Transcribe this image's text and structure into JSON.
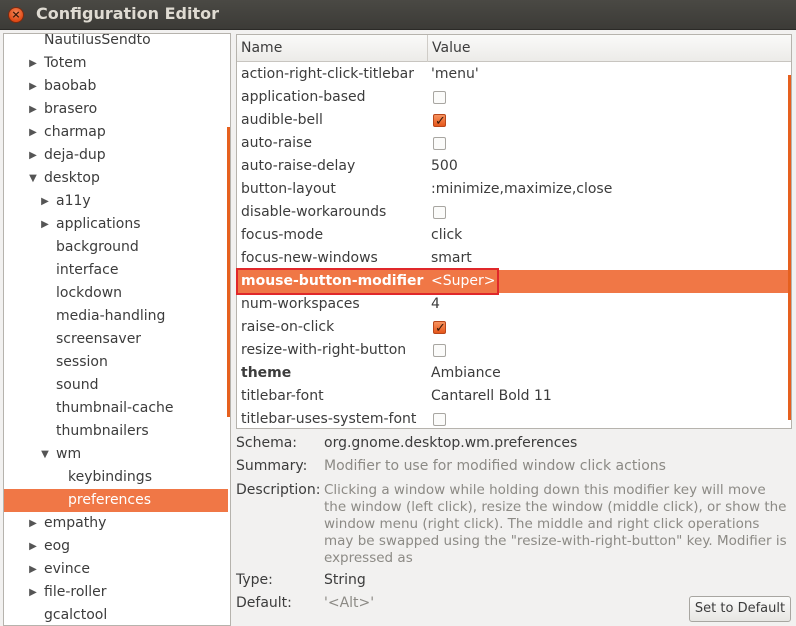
{
  "window": {
    "title": "Configuration Editor"
  },
  "tree": [
    {
      "label": "NautilusSendto",
      "depth": 0,
      "expander": "none",
      "selected": false
    },
    {
      "label": "Totem",
      "depth": 0,
      "expander": "collapsed",
      "selected": false
    },
    {
      "label": "baobab",
      "depth": 0,
      "expander": "collapsed",
      "selected": false
    },
    {
      "label": "brasero",
      "depth": 0,
      "expander": "collapsed",
      "selected": false
    },
    {
      "label": "charmap",
      "depth": 0,
      "expander": "collapsed",
      "selected": false
    },
    {
      "label": "deja-dup",
      "depth": 0,
      "expander": "collapsed",
      "selected": false
    },
    {
      "label": "desktop",
      "depth": 0,
      "expander": "expanded",
      "selected": false
    },
    {
      "label": "a11y",
      "depth": 1,
      "expander": "collapsed",
      "selected": false
    },
    {
      "label": "applications",
      "depth": 1,
      "expander": "collapsed",
      "selected": false
    },
    {
      "label": "background",
      "depth": 1,
      "expander": "none",
      "selected": false
    },
    {
      "label": "interface",
      "depth": 1,
      "expander": "none",
      "selected": false
    },
    {
      "label": "lockdown",
      "depth": 1,
      "expander": "none",
      "selected": false
    },
    {
      "label": "media-handling",
      "depth": 1,
      "expander": "none",
      "selected": false
    },
    {
      "label": "screensaver",
      "depth": 1,
      "expander": "none",
      "selected": false
    },
    {
      "label": "session",
      "depth": 1,
      "expander": "none",
      "selected": false
    },
    {
      "label": "sound",
      "depth": 1,
      "expander": "none",
      "selected": false
    },
    {
      "label": "thumbnail-cache",
      "depth": 1,
      "expander": "none",
      "selected": false
    },
    {
      "label": "thumbnailers",
      "depth": 1,
      "expander": "none",
      "selected": false
    },
    {
      "label": "wm",
      "depth": 1,
      "expander": "expanded",
      "selected": false
    },
    {
      "label": "keybindings",
      "depth": 2,
      "expander": "none",
      "selected": false
    },
    {
      "label": "preferences",
      "depth": 2,
      "expander": "none",
      "selected": true
    },
    {
      "label": "empathy",
      "depth": 0,
      "expander": "collapsed",
      "selected": false
    },
    {
      "label": "eog",
      "depth": 0,
      "expander": "collapsed",
      "selected": false
    },
    {
      "label": "evince",
      "depth": 0,
      "expander": "collapsed",
      "selected": false
    },
    {
      "label": "file-roller",
      "depth": 0,
      "expander": "collapsed",
      "selected": false
    },
    {
      "label": "gcalctool",
      "depth": 0,
      "expander": "none",
      "selected": false
    }
  ],
  "table": {
    "headers": {
      "name": "Name",
      "value": "Value"
    },
    "rows": [
      {
        "name": "action-right-click-titlebar",
        "type": "text",
        "value": "'menu'"
      },
      {
        "name": "application-based",
        "type": "check",
        "checked": false
      },
      {
        "name": "audible-bell",
        "type": "check",
        "checked": true
      },
      {
        "name": "auto-raise",
        "type": "check",
        "checked": false
      },
      {
        "name": "auto-raise-delay",
        "type": "text",
        "value": "500"
      },
      {
        "name": "button-layout",
        "type": "text",
        "value": ":minimize,maximize,close"
      },
      {
        "name": "disable-workarounds",
        "type": "check",
        "checked": false
      },
      {
        "name": "focus-mode",
        "type": "text",
        "value": "click"
      },
      {
        "name": "focus-new-windows",
        "type": "text",
        "value": "smart"
      },
      {
        "name": "mouse-button-modifier",
        "type": "text",
        "value": "<Super>",
        "selected": true
      },
      {
        "name": "num-workspaces",
        "type": "text",
        "value": "4"
      },
      {
        "name": "raise-on-click",
        "type": "check",
        "checked": true
      },
      {
        "name": "resize-with-right-button",
        "type": "check",
        "checked": false
      },
      {
        "name": "theme",
        "type": "text",
        "value": "Ambiance",
        "bold": true
      },
      {
        "name": "titlebar-font",
        "type": "text",
        "value": "Cantarell Bold 11"
      },
      {
        "name": "titlebar-uses-system-font",
        "type": "check",
        "checked": false
      }
    ]
  },
  "details": {
    "schema_label": "Schema:",
    "schema_value": "org.gnome.desktop.wm.preferences",
    "summary_label": "Summary:",
    "summary_value": "Modifier to use for modified window click actions",
    "description_label": "Description:",
    "description_value": "Clicking a window while holding down this modifier key will move the window (left click), resize the window (middle click), or show the window menu (right click). The middle and right click operations may be swapped using the \"resize-with-right-button\" key. Modifier is expressed as",
    "type_label": "Type:",
    "type_value": "String",
    "default_label": "Default:",
    "default_value": "'<Alt>'"
  },
  "buttons": {
    "set_default": "Set to Default"
  },
  "colors": {
    "accent": "#f07746",
    "highlight_box": "#e0282a",
    "titlebar": "#3c3b37"
  }
}
